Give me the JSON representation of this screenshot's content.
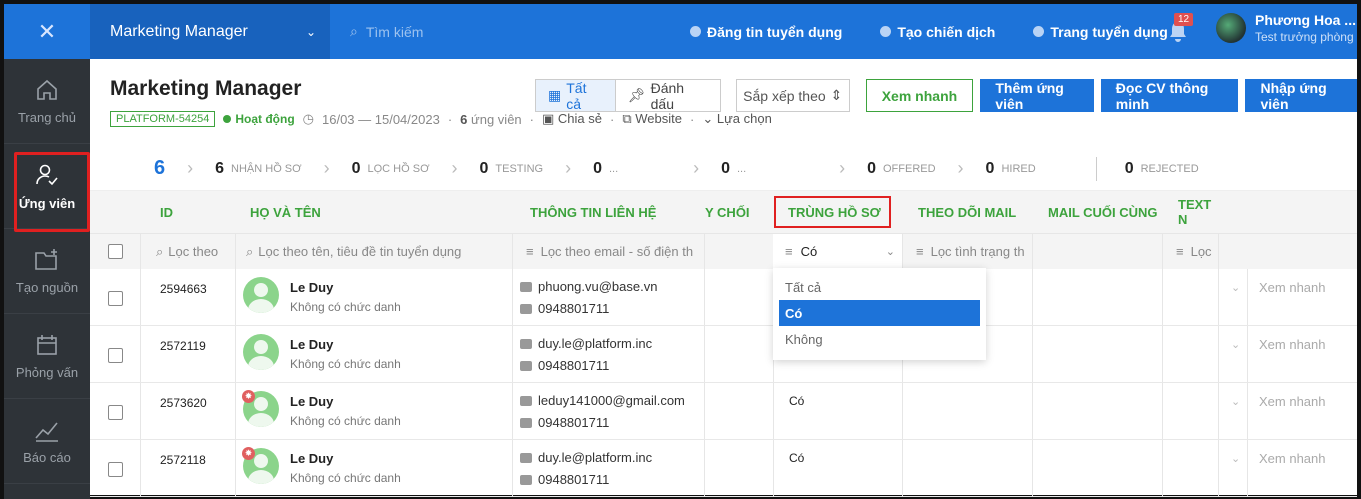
{
  "topbar": {
    "project": "Marketing Manager",
    "search_placeholder": "Tìm kiếm",
    "links": [
      "Đăng tin tuyển dụng",
      "Tạo chiến dịch",
      "Trang tuyển dụng"
    ],
    "notif_count": "12",
    "user_name": "Phương Hoa ...",
    "user_role": "Test trưởng phòng"
  },
  "sidebar": {
    "items": [
      {
        "label": "Trang chủ",
        "icon": "home-icon"
      },
      {
        "label": "Ứng viên",
        "icon": "candidate-icon"
      },
      {
        "label": "Tạo nguồn",
        "icon": "folder-add-icon"
      },
      {
        "label": "Phỏng vấn",
        "icon": "calendar-icon"
      },
      {
        "label": "Báo cáo",
        "icon": "chart-line-icon"
      }
    ]
  },
  "header": {
    "title": "Marketing Manager",
    "code": "PLATFORM-54254",
    "status": "Hoạt động",
    "date_range": "16/03 — 15/04/2023",
    "candidates_bold": "6",
    "candidates_text": "ứng viên",
    "share": "Chia sẻ",
    "website": "Website",
    "options": "Lựa chọn",
    "tab_all": "Tất cả",
    "tab_marked": "Đánh dấu",
    "sort": "Sắp xếp theo",
    "quick_view": "Xem nhanh",
    "add_candidate": "Thêm ứng viên",
    "smart_cv": "Đọc CV thông minh",
    "import": "Nhập ứng viên"
  },
  "pipeline": {
    "total": "6",
    "stages": [
      {
        "count": "6",
        "label": "NHẬN HỒ SƠ"
      },
      {
        "count": "0",
        "label": "LỌC HỒ SƠ"
      },
      {
        "count": "0",
        "label": "TESTING"
      },
      {
        "count": "0",
        "label": "..."
      },
      {
        "count": "0",
        "label": "..."
      },
      {
        "count": "0",
        "label": "OFFERED"
      },
      {
        "count": "0",
        "label": "HIRED"
      },
      {
        "count": "0",
        "label": "REJECTED"
      }
    ]
  },
  "columns": {
    "id": "ID",
    "name": "HỌ VÀ TÊN",
    "contact": "THÔNG TIN LIÊN HỆ",
    "reject": "Y CHỐI",
    "dup": "TRÙNG HỒ SƠ",
    "mail_track": "THEO DÕI MAIL",
    "last_mail": "MAIL CUỐI CÙNG",
    "text": "TEXT N"
  },
  "filters": {
    "id": "Lọc theo",
    "name": "Lọc theo tên, tiêu đề tin tuyển dụng",
    "contact": "Lọc theo email - số điện th",
    "dup_value": "Có",
    "mail": "Lọc tình trạng th",
    "text": "Lọc"
  },
  "dropdown": {
    "options": [
      "Tất cả",
      "Có",
      "Không"
    ],
    "selected": "Có"
  },
  "rows": [
    {
      "id": "2594663",
      "name": "Le Duy",
      "title": "Không có chức danh",
      "email": "phuong.vu@base.vn",
      "phone": "0948801711",
      "dup": "",
      "hot": false,
      "action": "Xem nhanh"
    },
    {
      "id": "2572119",
      "name": "Le Duy",
      "title": "Không có chức danh",
      "email": "duy.le@platform.inc",
      "phone": "0948801711",
      "dup": "",
      "hot": false,
      "action": "Xem nhanh"
    },
    {
      "id": "2573620",
      "name": "Le Duy",
      "title": "Không có chức danh",
      "email": "leduy141000@gmail.com",
      "phone": "0948801711",
      "dup": "Có",
      "hot": true,
      "action": "Xem nhanh"
    },
    {
      "id": "2572118",
      "name": "Le Duy",
      "title": "Không có chức danh",
      "email": "duy.le@platform.inc",
      "phone": "0948801711",
      "dup": "Có",
      "hot": true,
      "action": "Xem nhanh"
    }
  ]
}
